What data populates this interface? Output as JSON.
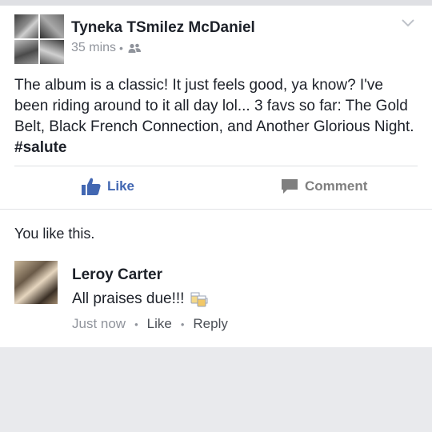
{
  "post": {
    "author": "Tyneka TSmilez McDaniel",
    "time": "35 mins",
    "privacy_icon": "friends-icon",
    "text_main": "The album is a classic! It just feels good, ya know? I've been riding around to it all day lol... 3 favs so far: The Gold Belt, Black French Connection, and Another Glorious Night. ",
    "hashtag": "#salute"
  },
  "actions": {
    "like_label": "Like",
    "comment_label": "Comment",
    "like_color": "#4267b2"
  },
  "likes_summary": "You like this.",
  "comment": {
    "author": "Leroy Carter",
    "text": "All praises due!!!",
    "emoji_icon": "cheers-mugs-icon",
    "time": "Just now",
    "like_label": "Like",
    "reply_label": "Reply",
    "separator": "•"
  }
}
